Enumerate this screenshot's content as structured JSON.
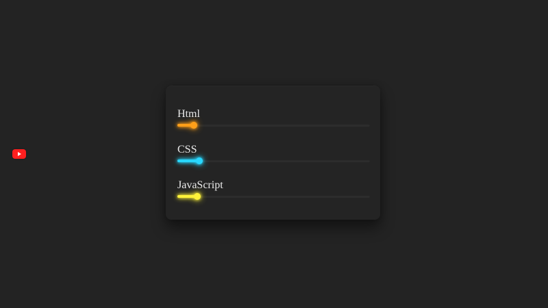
{
  "youtube_badge": {
    "icon": "youtube-play-icon",
    "color": "#ff1f1f"
  },
  "skills": [
    {
      "label": "Html",
      "value": 0.085,
      "color": "#ff9f19"
    },
    {
      "label": "CSS",
      "value": 0.113,
      "color": "#29d7ff"
    },
    {
      "label": "JavaScript",
      "value": 0.102,
      "color": "#fff33a"
    }
  ],
  "colors": {
    "background": "#232323",
    "card": "#242424",
    "track": "#2d2d2d",
    "text": "#eaeaea"
  }
}
